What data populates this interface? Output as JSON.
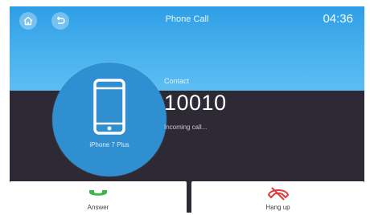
{
  "header": {
    "title": "Phone Call",
    "clock": "04:36",
    "home_icon": "home-icon",
    "back_icon": "back-icon"
  },
  "device": {
    "label": "iPhone 7 Plus",
    "icon": "smartphone-icon"
  },
  "call": {
    "contact_label": "Contact",
    "number": "10010",
    "status": "Incoming call..."
  },
  "actions": {
    "answer_label": "Answer",
    "answer_icon": "phone-answer-icon",
    "answer_color": "#3cb84a",
    "hangup_label": "Hang up",
    "hangup_icon": "phone-hangup-icon",
    "hangup_color": "#e0393e"
  },
  "colors": {
    "header_blue": "#49b1ee",
    "body_dark": "#2d2a36",
    "device_circle": "#2f8fd0"
  }
}
